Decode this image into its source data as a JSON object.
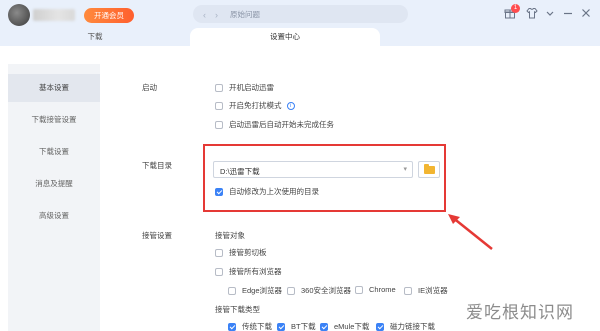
{
  "titlebar": {
    "vip_label": "开通会员",
    "nav_back": "‹",
    "nav_forward": "›",
    "search_placeholder": "原始问题",
    "icons": [
      "gift-icon",
      "shirt-icon",
      "menu-icon",
      "minimize-icon",
      "maximize-icon",
      "close-icon"
    ],
    "gift_badge": "1"
  },
  "tabs": [
    {
      "label": "下载",
      "active": false
    },
    {
      "label": "设置中心",
      "active": true
    }
  ],
  "sidebar": {
    "items": [
      {
        "label": "基本设置",
        "active": true
      },
      {
        "label": "下载接管设置",
        "active": false
      },
      {
        "label": "下载设置",
        "active": false
      },
      {
        "label": "消息及提醒",
        "active": false
      },
      {
        "label": "高级设置",
        "active": false
      }
    ]
  },
  "startup": {
    "label": "启动",
    "options": [
      {
        "label": "开机启动迅雷",
        "checked": false
      },
      {
        "label": "开启免打扰模式",
        "checked": false,
        "info_icon": "i"
      },
      {
        "label": "启动迅雷后自动开始未完成任务",
        "checked": false
      }
    ]
  },
  "download_dir": {
    "label": "下载目录",
    "path": "D:\\迅雷下载",
    "dropdown_arrow": "▾",
    "auto_modify_label": "自动修改为上次使用的目录",
    "auto_modify_checked": true
  },
  "takeover": {
    "label": "接管设置",
    "objects_label": "接管对象",
    "clipboard": {
      "label": "接管剪切板",
      "checked": false
    },
    "all_browsers": {
      "label": "接管所有浏览器",
      "checked": false
    },
    "browsers": [
      {
        "label": "Edge浏览器",
        "checked": false
      },
      {
        "label": "360安全浏览器",
        "checked": false
      },
      {
        "label": "Chrome",
        "checked": false
      },
      {
        "label": "IE浏览器",
        "checked": false
      }
    ],
    "types_label": "接管下载类型",
    "types": [
      {
        "label": "传统下载",
        "checked": true
      },
      {
        "label": "BT下载",
        "checked": true
      },
      {
        "label": "eMule下载",
        "checked": true
      },
      {
        "label": "磁力链接下载",
        "checked": true
      }
    ]
  },
  "watermark": "爱吃根知识网"
}
